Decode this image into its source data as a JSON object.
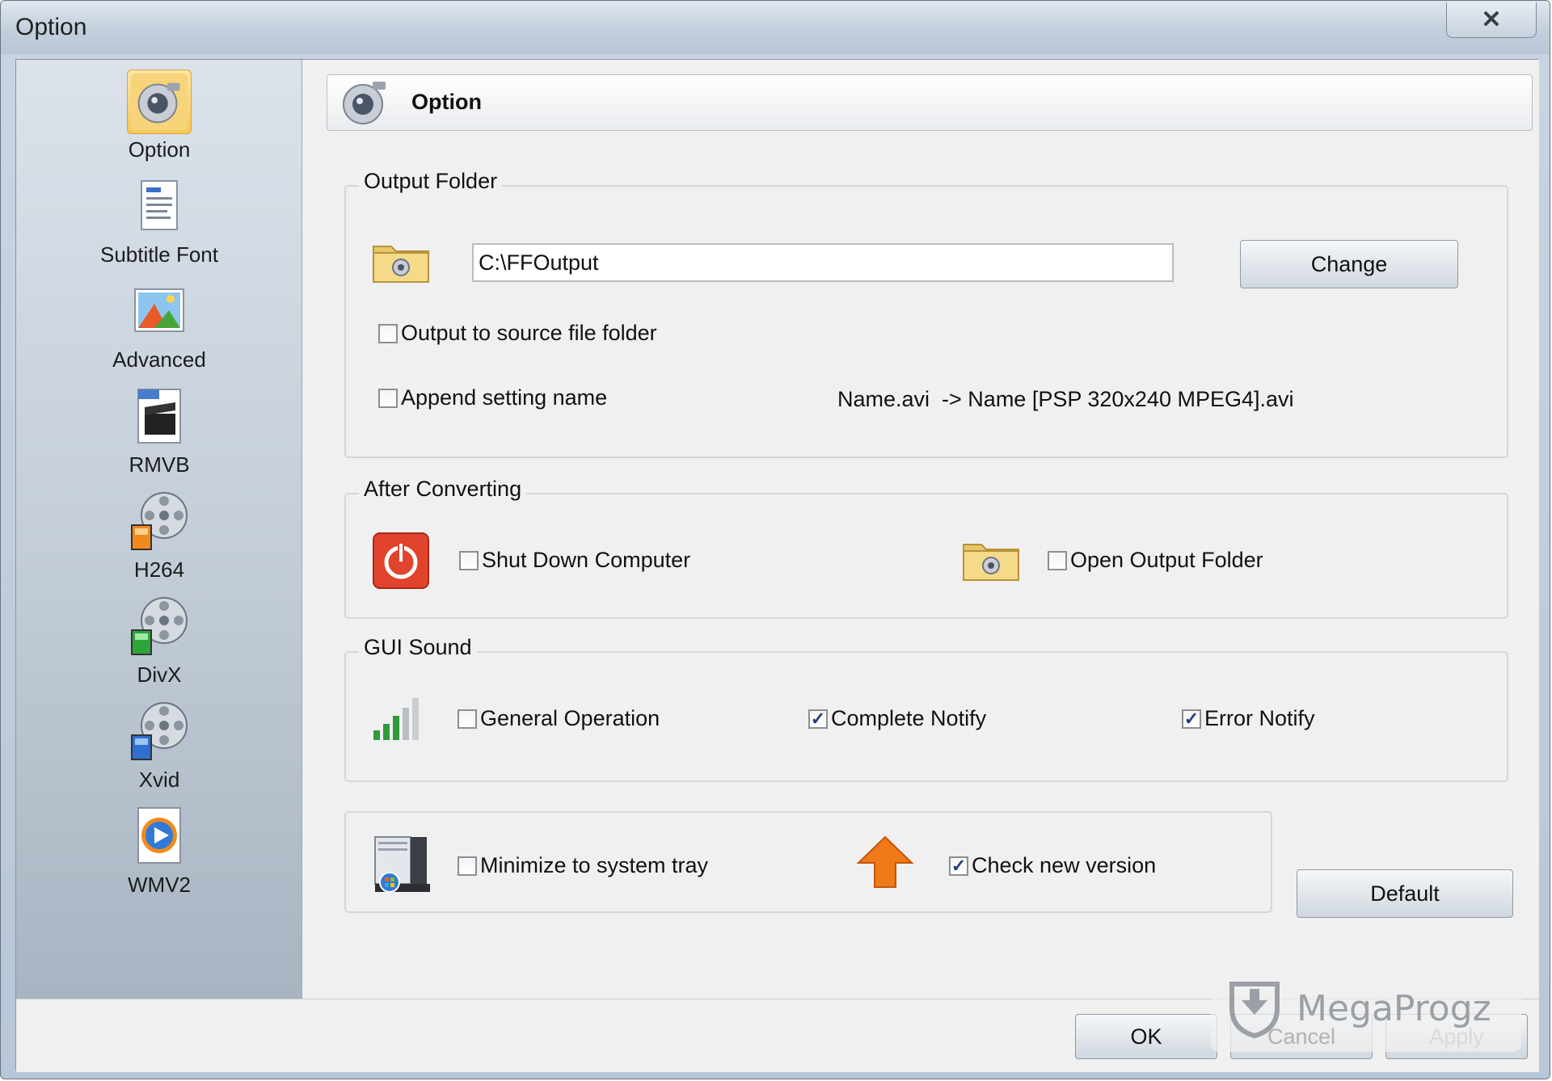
{
  "window": {
    "title": "Option",
    "close_glyph": "✕"
  },
  "sidebar": {
    "items": [
      {
        "label": "Option",
        "icon": "camera-icon",
        "selected": true
      },
      {
        "label": "Subtitle Font",
        "icon": "document-icon"
      },
      {
        "label": "Advanced",
        "icon": "picture-icon"
      },
      {
        "label": "RMVB",
        "icon": "clapboard-icon"
      },
      {
        "label": "H264",
        "icon": "film-reel-orange-icon"
      },
      {
        "label": "DivX",
        "icon": "film-reel-green-icon"
      },
      {
        "label": "Xvid",
        "icon": "film-reel-blue-icon"
      },
      {
        "label": "WMV2",
        "icon": "media-player-icon"
      }
    ]
  },
  "header": {
    "title": "Option"
  },
  "output_folder": {
    "legend": "Output Folder",
    "path": "C:\\FFOutput",
    "change_label": "Change",
    "output_to_source_label": "Output to source file folder",
    "output_to_source_checked": false,
    "append_setting_label": "Append setting name",
    "append_setting_checked": false,
    "example_text": "Name.avi  -> Name [PSP 320x240 MPEG4].avi"
  },
  "after_converting": {
    "legend": "After Converting",
    "shutdown_label": "Shut Down Computer",
    "shutdown_checked": false,
    "open_folder_label": "Open Output Folder",
    "open_folder_checked": false
  },
  "gui_sound": {
    "legend": "GUI Sound",
    "general_label": "General Operation",
    "general_checked": false,
    "complete_label": "Complete Notify",
    "complete_checked": true,
    "error_label": "Error Notify",
    "error_checked": true
  },
  "misc": {
    "minimize_label": "Minimize to system tray",
    "minimize_checked": false,
    "check_version_label": "Check new version",
    "check_version_checked": true,
    "default_label": "Default"
  },
  "footer": {
    "ok_label": "OK",
    "cancel_label": "Cancel",
    "apply_label": "Apply"
  },
  "watermark": {
    "text": "MegaProgz"
  },
  "colors": {
    "accent": "#f7c75a",
    "shutdown_red": "#e0442c",
    "sound_green": "#2e9a3a",
    "arrow_orange": "#f07a1a"
  },
  "check_glyph": "✓"
}
